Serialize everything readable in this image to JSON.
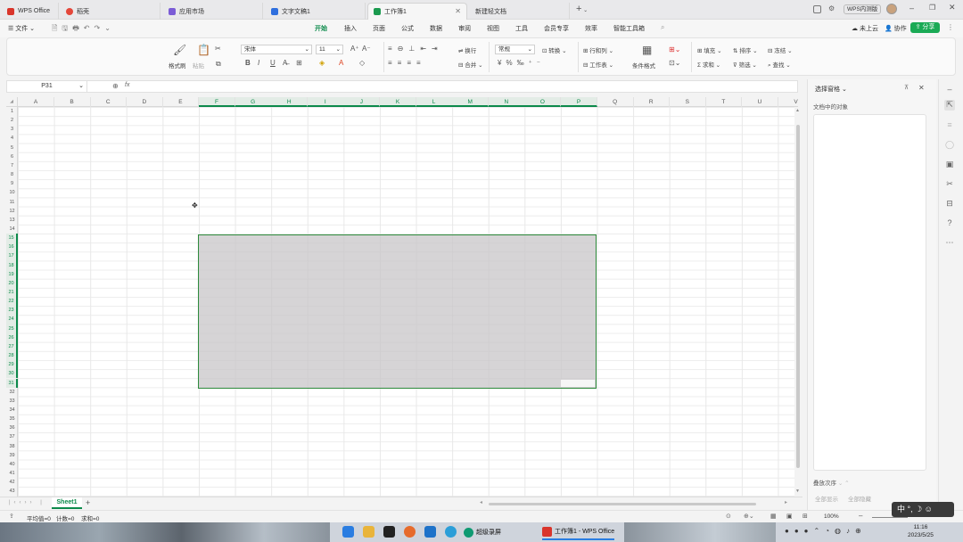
{
  "tabs": {
    "items": [
      {
        "label": "WPS Office"
      },
      {
        "label": "稻壳"
      },
      {
        "label": "应用市场"
      },
      {
        "label": "文字文稿1"
      },
      {
        "label": "工作簿1"
      },
      {
        "label": "新建轻文档"
      }
    ],
    "new_tab": "+",
    "wps_inner": "WPS内测版"
  },
  "menu": {
    "file": "文件",
    "items": [
      "开始",
      "插入",
      "页面",
      "公式",
      "数据",
      "审阅",
      "视图",
      "工具",
      "会员专享",
      "效率",
      "智能工具箱"
    ],
    "active": "开始",
    "upload": "未上云",
    "collab": "协作",
    "share": "分享"
  },
  "ribbon": {
    "format_painter": "格式刷",
    "paste": "粘贴",
    "font_name": "宋体",
    "font_size": "11",
    "wrap": "换行",
    "merge": "合并",
    "number_format": "常规",
    "convert": "转换",
    "row_col": "行和列",
    "worksheet": "工作表",
    "cond_format": "条件格式",
    "fill": "填充",
    "sort": "排序",
    "freeze": "冻结",
    "sum": "求和",
    "filter": "筛选",
    "find": "查找"
  },
  "formula_bar": {
    "cell_ref": "P31",
    "fx": "fx"
  },
  "grid": {
    "columns": [
      "A",
      "B",
      "C",
      "D",
      "E",
      "F",
      "G",
      "H",
      "I",
      "J",
      "K",
      "L",
      "M",
      "N",
      "O",
      "P",
      "Q",
      "R",
      "S",
      "T",
      "U",
      "V"
    ],
    "highlight_columns": [
      "F",
      "G",
      "H",
      "I",
      "J",
      "K",
      "L",
      "M",
      "N",
      "O",
      "P"
    ],
    "rows": [
      "1",
      "2",
      "3",
      "4",
      "5",
      "6",
      "7",
      "8",
      "9",
      "10",
      "11",
      "12",
      "13",
      "14",
      "15",
      "16",
      "17",
      "18",
      "19",
      "20",
      "21",
      "22",
      "23",
      "24",
      "25",
      "26",
      "27",
      "28",
      "29",
      "30",
      "31",
      "32",
      "33",
      "34",
      "35",
      "36",
      "37",
      "38",
      "39",
      "40",
      "41",
      "42",
      "43"
    ],
    "selection": "F15:P31"
  },
  "sheet_tabs": {
    "active": "Sheet1",
    "add": "+"
  },
  "status": {
    "average": "平均值=0",
    "count": "计数=0",
    "sum": "求和=0",
    "zoom": "100%"
  },
  "selection_pane": {
    "title": "选择窗格",
    "subtitle": "文档中的对象",
    "order": "叠放次序",
    "show_all": "全部显示",
    "hide_all": "全部隐藏"
  },
  "taskbar": {
    "app1": "超级录屏",
    "app2": "工作簿1 - WPS Office",
    "time": "11:16",
    "date": "2023/5/25",
    "ime": "中"
  },
  "colors": {
    "accent": "#0c8a4b",
    "selection_border": "#2e8b3c",
    "share_button": "#1aaa55"
  }
}
